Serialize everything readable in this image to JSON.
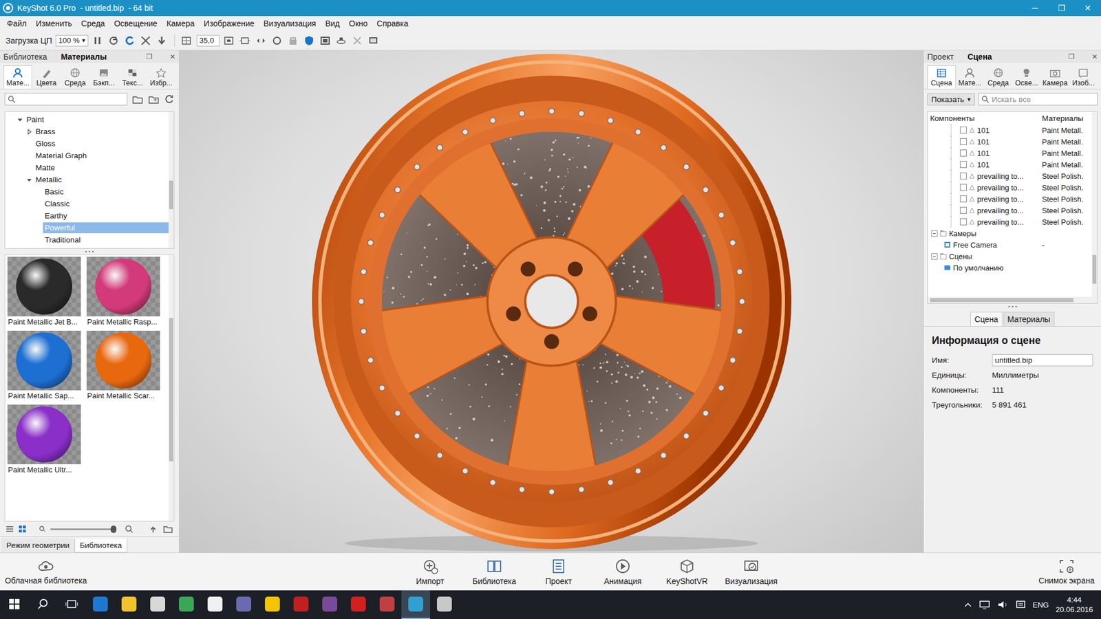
{
  "window": {
    "title": "KeyShot 6.0 Pro  - untitled.bip  - 64 bit",
    "controls": [
      "─",
      "❐",
      "✕"
    ]
  },
  "menu": [
    "Файл",
    "Изменить",
    "Среда",
    "Освещение",
    "Камера",
    "Изображение",
    "Визуализация",
    "Вид",
    "Окно",
    "Справка"
  ],
  "toolbar": {
    "cpu_label": "Загрузка ЦП",
    "cpu_value": "100 %",
    "cpu_arrow": "▾",
    "fov": "35,0"
  },
  "left_panel": {
    "tabs": [
      {
        "label": "Библиотека",
        "selected": false
      },
      {
        "label": "Материалы",
        "selected": true
      }
    ],
    "header_controls": [
      "❐",
      "✕"
    ],
    "icon_tabs": [
      {
        "label": "Мате...",
        "selected": true
      },
      {
        "label": "Цвета",
        "selected": false
      },
      {
        "label": "Среда",
        "selected": false
      },
      {
        "label": "Бэкп...",
        "selected": false
      },
      {
        "label": "Текс...",
        "selected": false
      },
      {
        "label": "Избр...",
        "selected": false
      }
    ],
    "tree": [
      {
        "label": "Paint",
        "depth": 0,
        "kind": "folder",
        "expanded": true,
        "selected": false
      },
      {
        "label": "Brass",
        "depth": 1,
        "kind": "folder",
        "expanded": false,
        "selected": false
      },
      {
        "label": "Gloss",
        "depth": 1,
        "kind": "leaf",
        "expanded": false,
        "selected": false
      },
      {
        "label": "Material Graph",
        "depth": 1,
        "kind": "leaf",
        "expanded": false,
        "selected": false
      },
      {
        "label": "Matte",
        "depth": 1,
        "kind": "leaf",
        "expanded": false,
        "selected": false
      },
      {
        "label": "Metallic",
        "depth": 1,
        "kind": "folder",
        "expanded": true,
        "selected": false
      },
      {
        "label": "Basic",
        "depth": 2,
        "kind": "leaf",
        "expanded": false,
        "selected": false
      },
      {
        "label": "Classic",
        "depth": 2,
        "kind": "leaf",
        "expanded": false,
        "selected": false
      },
      {
        "label": "Earthy",
        "depth": 2,
        "kind": "leaf",
        "expanded": false,
        "selected": false
      },
      {
        "label": "Powerful",
        "depth": 2,
        "kind": "leaf",
        "expanded": false,
        "selected": true
      },
      {
        "label": "Traditional",
        "depth": 2,
        "kind": "leaf",
        "expanded": false,
        "selected": false
      }
    ],
    "thumbnails": [
      {
        "label": "Paint Metallic Jet B...",
        "color": "#2a2a2a"
      },
      {
        "label": "Paint Metallic Rasp...",
        "color": "#d23a7a"
      },
      {
        "label": "Paint Metallic Sap...",
        "color": "#1d6fd2"
      },
      {
        "label": "Paint Metallic Scar...",
        "color": "#e8680e"
      },
      {
        "label": "Paint Metallic Ultr...",
        "color": "#8a2fc8"
      }
    ],
    "zoom": {
      "level": 1
    },
    "bottom_tabs": [
      {
        "label": "Режим геометрии",
        "selected": false
      },
      {
        "label": "Библиотека",
        "selected": true
      }
    ]
  },
  "right_panel": {
    "tabs": [
      {
        "label": "Проект",
        "selected": false
      },
      {
        "label": "Сцена",
        "selected": true
      }
    ],
    "header_controls": [
      "❐",
      "✕"
    ],
    "icon_tabs": [
      {
        "label": "Сцена",
        "selected": true
      },
      {
        "label": "Мате...",
        "selected": false
      },
      {
        "label": "Среда",
        "selected": false
      },
      {
        "label": "Осве...",
        "selected": false
      },
      {
        "label": "Камера",
        "selected": false
      },
      {
        "label": "Изоб...",
        "selected": false
      }
    ],
    "show_button": {
      "label": "Показать",
      "arrow": "▾"
    },
    "search": {
      "placeholder": "Искать все"
    },
    "columns": [
      "Компоненты",
      "Материалы"
    ],
    "rows": [
      {
        "kind": "part",
        "name": "101",
        "material": "Paint Metall.",
        "checked": false
      },
      {
        "kind": "part",
        "name": "101",
        "material": "Paint Metall.",
        "checked": false
      },
      {
        "kind": "part",
        "name": "101",
        "material": "Paint Metall.",
        "checked": false
      },
      {
        "kind": "part",
        "name": "101",
        "material": "Paint Metall.",
        "checked": false
      },
      {
        "kind": "part",
        "name": "prevailing to...",
        "material": "Steel Polish.",
        "checked": false
      },
      {
        "kind": "part",
        "name": "prevailing to...",
        "material": "Steel Polish.",
        "checked": false
      },
      {
        "kind": "part",
        "name": "prevailing to...",
        "material": "Steel Polish.",
        "checked": false
      },
      {
        "kind": "part",
        "name": "prevailing to...",
        "material": "Steel Polish.",
        "checked": false
      },
      {
        "kind": "part",
        "name": "prevailing to...",
        "material": "Steel Polish.",
        "checked": false
      },
      {
        "kind": "group",
        "name": "Камеры",
        "toggle": "−"
      },
      {
        "kind": "camera",
        "name": "Free Camera",
        "material": "-"
      },
      {
        "kind": "group",
        "name": "Сцены",
        "toggle": "−"
      },
      {
        "kind": "scene",
        "name": "По умолчанию"
      }
    ],
    "subtabs": [
      {
        "label": "Сцена",
        "selected": true
      },
      {
        "label": "Материалы",
        "selected": false
      }
    ],
    "info": {
      "title": "Информация о сцене",
      "fields": [
        {
          "label": "Имя:",
          "value": "untitled.bip",
          "kind": "input"
        },
        {
          "label": "Единицы:",
          "value": "Миллиметры",
          "kind": "text"
        },
        {
          "label": "Компоненты:",
          "value": "111",
          "kind": "text"
        },
        {
          "label": "Треугольники:",
          "value": "5 891 461",
          "kind": "text"
        }
      ]
    }
  },
  "bottom_bar": {
    "cloud": "Облачная библиотека",
    "buttons": [
      "Импорт",
      "Библиотека",
      "Проект",
      "Анимация",
      "KeyShotVR",
      "Визуализация"
    ],
    "snapshot": "Снимок экрана"
  },
  "taskbar": {
    "apps": [
      {
        "color": "#1e78d2",
        "selected": false
      },
      {
        "color": "#f2c12e",
        "selected": false
      },
      {
        "color": "#d8d8d8",
        "selected": false
      },
      {
        "color": "#3aa757",
        "selected": false
      },
      {
        "color": "#f0f0f0",
        "selected": false
      },
      {
        "color": "#6a6ab0",
        "selected": false
      },
      {
        "color": "#f5c400",
        "selected": false
      },
      {
        "color": "#c02020",
        "selected": false
      },
      {
        "color": "#7a4a9a",
        "selected": false
      },
      {
        "color": "#d02020",
        "selected": false
      },
      {
        "color": "#c04040",
        "selected": false
      },
      {
        "color": "#30a0d0",
        "selected": true
      },
      {
        "color": "#c8c8c8",
        "selected": false
      }
    ],
    "tray": {
      "language": "ENG",
      "time": "4:44",
      "date": "20.06.2016"
    }
  }
}
